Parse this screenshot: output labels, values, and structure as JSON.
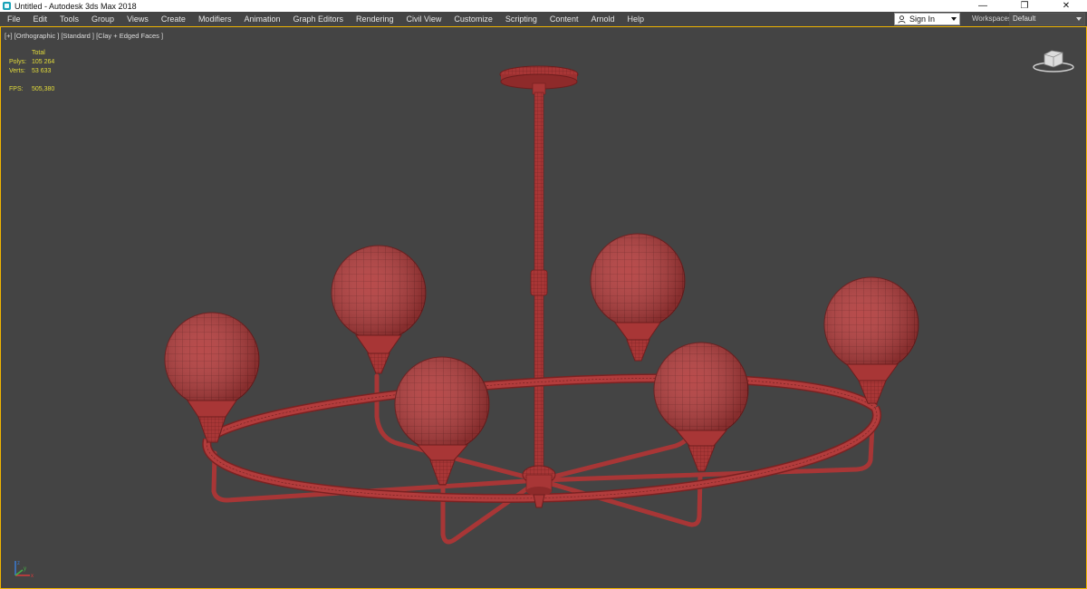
{
  "window": {
    "title": "Untitled - Autodesk 3ds Max 2018",
    "minimize_glyph": "—",
    "restore_glyph": "❐",
    "close_glyph": "✕"
  },
  "menu": {
    "items": [
      "File",
      "Edit",
      "Tools",
      "Group",
      "Views",
      "Create",
      "Modifiers",
      "Animation",
      "Graph Editors",
      "Rendering",
      "Civil View",
      "Customize",
      "Scripting",
      "Content",
      "Arnold",
      "Help"
    ]
  },
  "account": {
    "sign_in_label": "Sign In",
    "workspaces_label": "Workspaces:",
    "workspace_value": "Default"
  },
  "viewport": {
    "label": "[+] [Orthographic ] [Standard ] [Clay + Edged Faces ]",
    "stats": {
      "header": "Total",
      "polys_label": "Polys:",
      "polys_value": "105 264",
      "verts_label": "Verts:",
      "verts_value": "53 633",
      "fps_label": "FPS:",
      "fps_value": "505,380"
    },
    "axis": {
      "x": "x",
      "y": "y",
      "z": "z"
    }
  },
  "colors": {
    "clay": "#b23c3c",
    "clay_dark": "#7a2222",
    "viewport_bg": "#444444",
    "viewport_border": "#f0b400",
    "stats_text": "#e3dc3a"
  },
  "scene": {
    "object": "chandelier",
    "globe_count": 6
  }
}
